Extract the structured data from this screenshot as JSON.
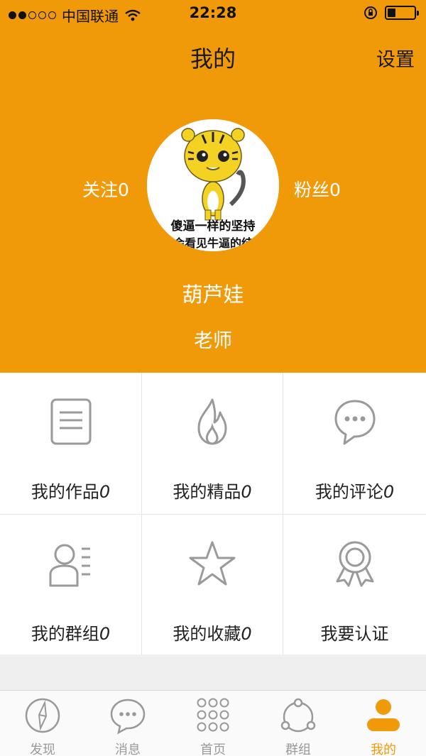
{
  "status_bar": {
    "carrier": "中国联通",
    "time": "22:28",
    "battery_level": 0.3
  },
  "nav": {
    "title": "我的",
    "settings_label": "设置"
  },
  "profile": {
    "follow_label": "关注0",
    "fans_label": "粉丝0",
    "avatar_caption_line1": "傻逼一样的坚持",
    "avatar_caption_line2": "会看见牛逼的结",
    "username": "葫芦娃",
    "role": "老师"
  },
  "grid": [
    {
      "label": "我的作品",
      "count": "0",
      "icon": "document-icon"
    },
    {
      "label": "我的精品",
      "count": "0",
      "icon": "flame-icon"
    },
    {
      "label": "我的评论",
      "count": "0",
      "icon": "chat-bubble-icon"
    },
    {
      "label": "我的群组",
      "count": "0",
      "icon": "group-list-icon"
    },
    {
      "label": "我的收藏",
      "count": "0",
      "icon": "star-icon"
    },
    {
      "label": "我要认证",
      "count": "",
      "icon": "badge-icon"
    }
  ],
  "tabbar": [
    {
      "label": "发现",
      "icon": "compass-icon",
      "active": false
    },
    {
      "label": "消息",
      "icon": "message-icon",
      "active": false
    },
    {
      "label": "首页",
      "icon": "grid-dots-icon",
      "active": false
    },
    {
      "label": "群组",
      "icon": "group-circle-icon",
      "active": false
    },
    {
      "label": "我的",
      "icon": "person-icon",
      "active": true
    }
  ],
  "colors": {
    "accent": "#f09a0a",
    "icon_gray": "#9a9a9a",
    "background": "#efefef"
  }
}
